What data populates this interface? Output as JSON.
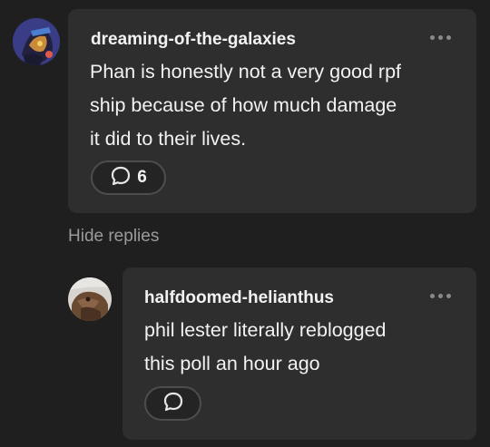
{
  "comments": [
    {
      "username": "dreaming-of-the-galaxies",
      "text_lines": [
        "Phan is honestly not a very good rpf",
        "ship because of how much damage",
        "it did to their lives."
      ],
      "reply_count": "6",
      "icons": {
        "more": "more-dots-icon",
        "reply": "speech-bubble-icon"
      }
    }
  ],
  "hide_replies_label": "Hide replies",
  "replies": [
    {
      "username": "halfdoomed-helianthus",
      "text_lines": [
        "phil lester literally reblogged",
        "this poll an hour ago"
      ],
      "icons": {
        "more": "more-dots-icon",
        "reply": "speech-bubble-icon"
      }
    }
  ],
  "colors": {
    "background": "#1f1f1f",
    "card": "#2e2e2e",
    "text": "#f2f2f2",
    "muted": "#9b9b9b",
    "button_border": "#4d4d4d"
  }
}
